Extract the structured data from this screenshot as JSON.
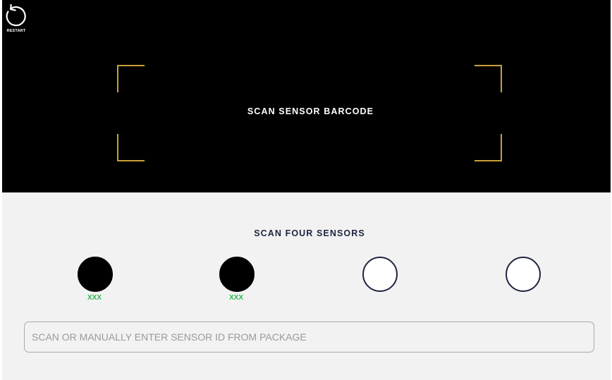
{
  "restart": {
    "label": "RESTART",
    "icon": "restart-icon"
  },
  "camera": {
    "prompt": "SCAN SENSOR BARCODE",
    "frame_color": "#c9a13b",
    "background": "#000000"
  },
  "panel": {
    "title": "SCAN FOUR SENSORS",
    "sensors": [
      {
        "status": "scanned",
        "label": "XXX"
      },
      {
        "status": "scanned",
        "label": "XXX"
      },
      {
        "status": "empty",
        "label": ""
      },
      {
        "status": "empty",
        "label": ""
      }
    ],
    "scanned_label_color": "#2db84c",
    "input": {
      "value": "",
      "placeholder": "SCAN OR MANUALLY ENTER SENSOR ID FROM PACKAGE"
    }
  }
}
